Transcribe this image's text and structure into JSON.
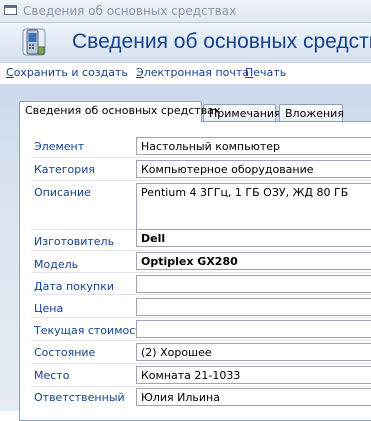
{
  "window": {
    "title": "Сведения об основных средствах"
  },
  "header": {
    "title": "Сведения об основных средствах",
    "icon": "mobile-device-icon"
  },
  "toolbar": {
    "save_new": "Сохранить и создать",
    "email": "Электронная почта",
    "print": "Печать"
  },
  "tabs": [
    {
      "label": "Сведения об основных средствах",
      "active": true
    },
    {
      "label": "Примечания",
      "active": false
    },
    {
      "label": "Вложения",
      "active": false
    }
  ],
  "fields": {
    "element": {
      "label": "Элемент",
      "value": "Настольный компьютер"
    },
    "category": {
      "label": "Категория",
      "value": "Компьютерное оборудование"
    },
    "description": {
      "label": "Описание",
      "value": "Pentium 4 3ГГц, 1 ГБ ОЗУ, ЖД 80 ГБ"
    },
    "manufacturer": {
      "label": "Изготовитель",
      "value": "Dell"
    },
    "model": {
      "label": "Модель",
      "value": "Optiplex GX280"
    },
    "purchase_date": {
      "label": "Дата покупки",
      "value": ""
    },
    "price": {
      "label": "Цена",
      "value": ""
    },
    "current_value": {
      "label": "Текущая стоимость",
      "value": ""
    },
    "condition": {
      "label": "Состояние",
      "value": "(2) Хорошее"
    },
    "location": {
      "label": "Место",
      "value": "Комната 21-1033"
    },
    "owner": {
      "label": "Ответственный",
      "value": "Юлия Ильина"
    }
  },
  "colors": {
    "accent": "#15428b",
    "band": "#d5e1ef"
  }
}
